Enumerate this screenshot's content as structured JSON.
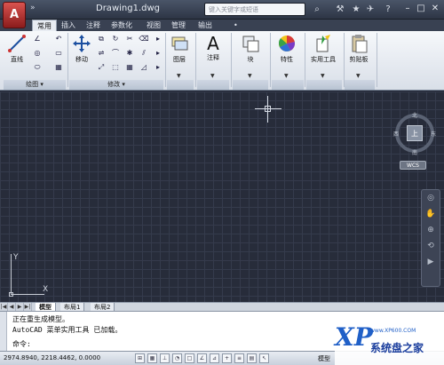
{
  "window": {
    "app_button_label": "A",
    "quick_access": "»",
    "document_title": "Drawing1.dwg",
    "search_placeholder": "键入关键字或短语",
    "controls": [
      "–",
      "□",
      "✕"
    ]
  },
  "ribbon_tabs": [
    "常用",
    "插入",
    "注释",
    "参数化",
    "视图",
    "管理",
    "输出",
    "•"
  ],
  "active_tab": "常用",
  "ribbon": {
    "draw_panel": {
      "title": "绘图",
      "tools": {
        "line": "直线"
      }
    },
    "modify_panel": {
      "title": "修改",
      "tools": {
        "move": "移动"
      }
    },
    "layers": "图层",
    "annotation": "注释",
    "block": "块",
    "properties": "特性",
    "utilities": "实用工具",
    "clipboard": "剪贴板",
    "annotation_glyph": "A"
  },
  "viewcube": {
    "top_label": "上",
    "north": "北",
    "south": "南",
    "east": "东",
    "west": "西"
  },
  "wcs_label": "WCS",
  "ucs": {
    "x": "X",
    "y": "Y"
  },
  "layout_tabs": [
    "模型",
    "布局1",
    "布局2"
  ],
  "active_layout": "模型",
  "command_history": [
    "正在重生成模型。",
    "AutoCAD 菜单实用工具 已加载。"
  ],
  "command_prompt": "命令:",
  "status": {
    "coordinates": "2974.8940, 2218.4462, 0.0000",
    "model_label": "模型"
  },
  "watermark": {
    "logo": "XP",
    "url": "www.XP600.COM",
    "name": "系统盘之家"
  }
}
